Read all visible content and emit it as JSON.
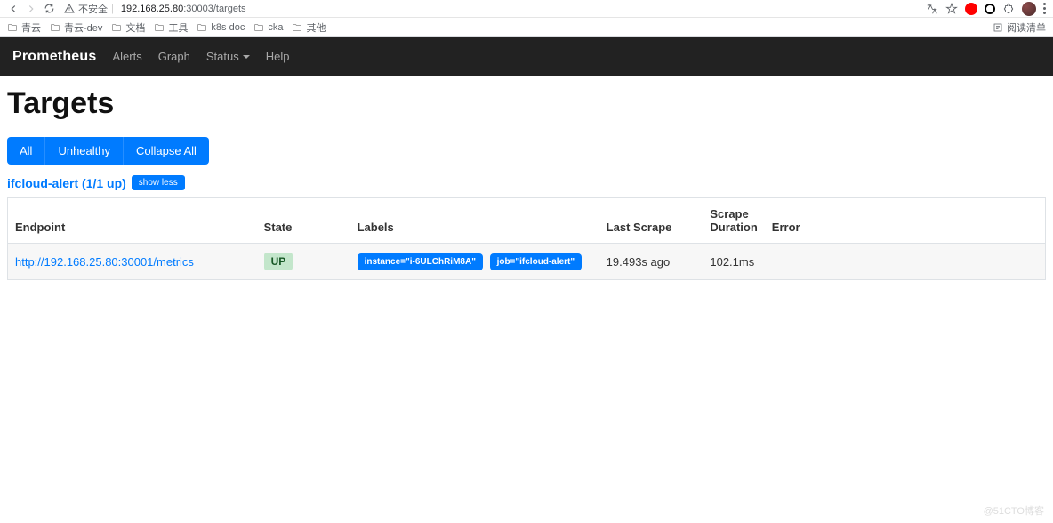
{
  "browser": {
    "security_text": "不安全",
    "url_host": "192.168.25.80",
    "url_rest": ":30003/targets",
    "reading_list": "阅读清单"
  },
  "bookmarks": [
    "青云",
    "青云-dev",
    "文档",
    "工具",
    "k8s doc",
    "cka",
    "其他"
  ],
  "navbar": {
    "brand": "Prometheus",
    "links": [
      "Alerts",
      "Graph",
      "Status",
      "Help"
    ]
  },
  "page": {
    "title": "Targets",
    "buttons": {
      "all": "All",
      "unhealthy": "Unhealthy",
      "collapse": "Collapse All"
    },
    "target_group": {
      "name": "ifcloud-alert (1/1 up)",
      "toggle": "show less"
    },
    "table": {
      "headers": {
        "endpoint": "Endpoint",
        "state": "State",
        "labels": "Labels",
        "last_scrape": "Last Scrape",
        "scrape_duration": "Scrape Duration",
        "error": "Error"
      },
      "rows": [
        {
          "endpoint": "http://192.168.25.80:30001/metrics",
          "state": "UP",
          "labels": [
            "instance=\"i-6ULChRiM8A\"",
            "job=\"ifcloud-alert\""
          ],
          "last_scrape": "19.493s ago",
          "duration": "102.1ms",
          "error": ""
        }
      ]
    }
  },
  "watermark": "@51CTO博客"
}
